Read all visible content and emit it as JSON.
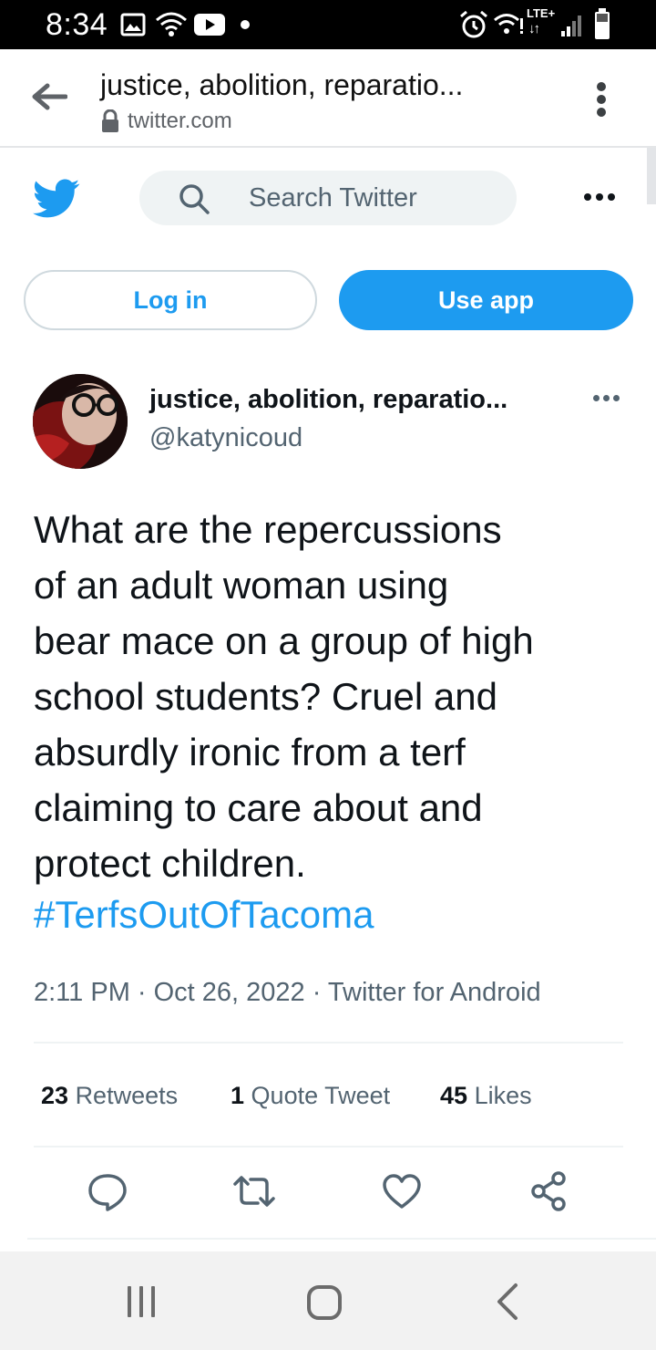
{
  "status_bar": {
    "time": "8:34",
    "network": "LTE+",
    "network_arrows": "↓↑",
    "left_icons": [
      "image-icon",
      "wifi-icon",
      "youtube-icon",
      "dot-icon"
    ],
    "right_icons": [
      "alarm-icon",
      "wifi-calling-icon",
      "signal-icon",
      "battery-icon"
    ]
  },
  "browser": {
    "title": "justice, abolition, reparatio...",
    "url": "twitter.com"
  },
  "header": {
    "search_placeholder": "Search Twitter",
    "login_label": "Log in",
    "use_app_label": "Use app",
    "accent_color": "#1d9bf0"
  },
  "tweet": {
    "author_name": "justice, abolition, reparatio...",
    "author_handle": "@katynicoud",
    "text": "What are the repercussions\nof an adult woman using\nbear mace on a group of high\nschool students? Cruel and\nabsurdly ironic from a terf\nclaiming to care about and\nprotect children.",
    "hashtag": "#TerfsOutOfTacoma",
    "meta": "2:11 PM · Oct 26, 2022 · Twitter for Android",
    "stats": {
      "retweets_count": "23",
      "retweets_label": "Retweets",
      "quotes_count": "1",
      "quotes_label": "Quote Tweet",
      "likes_count": "45",
      "likes_label": "Likes"
    },
    "actions": [
      "reply-icon",
      "retweet-icon",
      "like-icon",
      "share-icon"
    ]
  },
  "nav_bar": {
    "buttons": [
      "recents-button",
      "home-button",
      "back-button"
    ]
  }
}
